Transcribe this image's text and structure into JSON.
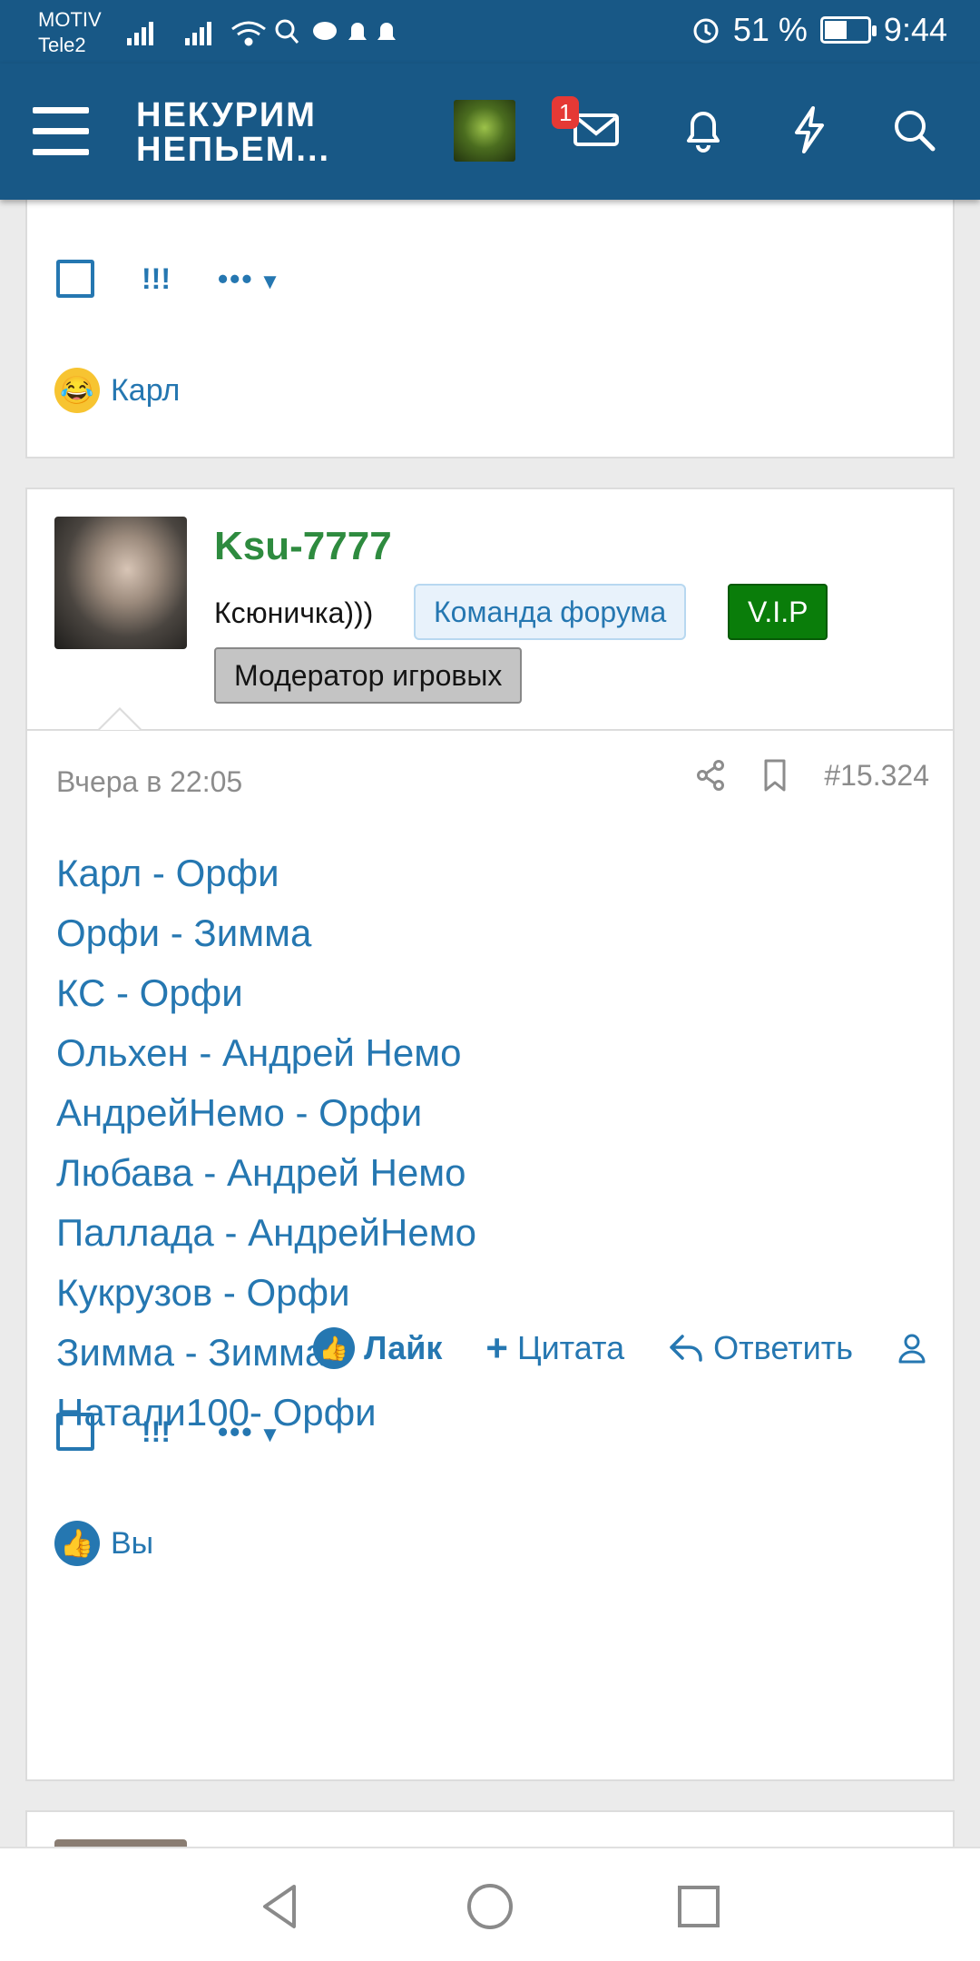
{
  "status_bar": {
    "carrier_1": "MOTIV",
    "carrier_2": "Tele2",
    "battery_percent": "51 %",
    "time": "9:44"
  },
  "header": {
    "logo_line1": "НЕКУРИМ",
    "logo_line2": "НЕПЬЕМ...",
    "messages_badge": "1"
  },
  "top_post": {
    "bangs_label": "!!!",
    "more_label": "•••",
    "reaction_user": "Карл"
  },
  "main_post": {
    "username": "Ksu-7777",
    "user_title": "Ксюничка)))",
    "badges": [
      "Команда форума",
      "V.I.P",
      "Модератор игровых"
    ],
    "date": "Вчера в 22:05",
    "post_number": "#15.324",
    "lines": [
      "Карл - Орфи",
      "Орфи - Зимма",
      "КС - Орфи",
      "Ольхен - Андрей Немо",
      "АндрейНемо - Орфи",
      "Любава - Андрей Немо",
      "Паллада - АндрейНемо",
      "Кукрузов - Орфи",
      "Зимма - Зимма",
      "Натали100- Орфи"
    ],
    "actions": {
      "like": "Лайк",
      "quote": "Цитата",
      "reply": "Ответить"
    },
    "bangs_label": "!!!",
    "more_label": "•••",
    "reaction_user": "Вы"
  },
  "colors": {
    "header_bg": "#185886",
    "link": "#2577b1",
    "username": "#2e8b3f",
    "vip": "#0a7d0a"
  }
}
